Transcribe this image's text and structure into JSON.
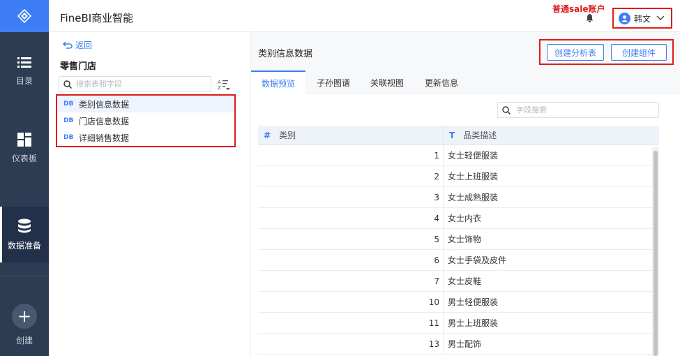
{
  "header": {
    "app_title": "FineBI商业智能",
    "user_name": "韩文",
    "annotation": "普通sale账户"
  },
  "nav": {
    "items": [
      {
        "label": "目录",
        "icon": "catalog-icon"
      },
      {
        "label": "仪表板",
        "icon": "dashboard-icon"
      },
      {
        "label": "数据准备",
        "icon": "database-icon",
        "active": true
      },
      {
        "label": "创建",
        "icon": "plus-icon"
      }
    ]
  },
  "left_panel": {
    "back_label": "返回",
    "group_title": "零售门店",
    "search_placeholder": "搜索表和字段",
    "tables": [
      {
        "badge": "DB",
        "name": "类别信息数据",
        "selected": true
      },
      {
        "badge": "DB",
        "name": "门店信息数据"
      },
      {
        "badge": "DB",
        "name": "详细销售数据"
      }
    ]
  },
  "right_panel": {
    "title": "类别信息数据",
    "buttons": {
      "create_analysis": "创建分析表",
      "create_component": "创建组件"
    },
    "tabs": [
      "数据预览",
      "子孙图谱",
      "关联视图",
      "更新信息"
    ],
    "active_tab": 0,
    "field_search_placeholder": "字段搜索",
    "columns": [
      {
        "type_icon": "#",
        "name": "类别"
      },
      {
        "type_icon": "T",
        "name": "品类描述"
      }
    ],
    "rows": [
      [
        "1",
        "女士轻便服装"
      ],
      [
        "2",
        "女士上班服装"
      ],
      [
        "3",
        "女士成熟服装"
      ],
      [
        "4",
        "女士内衣"
      ],
      [
        "5",
        "女士饰物"
      ],
      [
        "6",
        "女士手袋及皮件"
      ],
      [
        "7",
        "女士皮鞋"
      ],
      [
        "10",
        "男士轻便服装"
      ],
      [
        "11",
        "男士上班服装"
      ],
      [
        "13",
        "男士配饰"
      ]
    ]
  },
  "colors": {
    "accent": "#3d7df5",
    "nav_bg": "#2c3c52",
    "annotation_red": "#e01b1b"
  }
}
